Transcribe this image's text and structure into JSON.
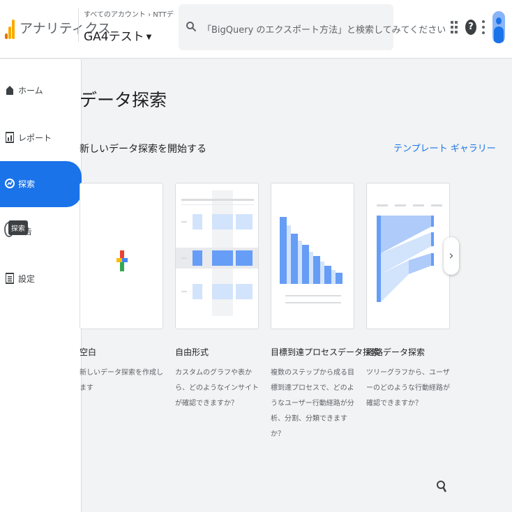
{
  "header": {
    "app_name": "アナリティクス",
    "breadcrumb": "すべてのアカウント › NTTデータ・スマート…",
    "property": "GA4テスト",
    "search_placeholder": "「BigQuery のエクスポート方法」と検索してみてください",
    "icons": [
      "apps-icon",
      "help-icon",
      "more-vert-icon",
      "avatar"
    ]
  },
  "sidebar": {
    "items": [
      {
        "label": "ホーム",
        "icon": "home-icon"
      },
      {
        "label": "レポート",
        "icon": "bar-chart-icon"
      },
      {
        "label": "探索",
        "icon": "explore-icon"
      },
      {
        "label": "広告",
        "icon": "ads-icon"
      },
      {
        "label": "設定",
        "icon": "list-icon"
      }
    ],
    "tooltip": "探索"
  },
  "main": {
    "title": "データ探索",
    "section_title": "新しいデータ探索を開始する",
    "gallery_link": "テンプレート ギャラリー",
    "cards": [
      {
        "title": "空白",
        "description": "新しいデータ探索を作成します"
      },
      {
        "title": "自由形式",
        "description": "カスタムのグラフや表から、どのようなインサイトが確認できますか？"
      },
      {
        "title": "目標到達プロセスデータ探索",
        "description": "複数のステップから成る目標到達プロセスで、どのようなユーザー行動経路が分析、分割、分類できますか？"
      },
      {
        "title": "経路データ探索",
        "description": "ツリーグラフから、ユーザーのどのような行動経路が確認できますか？"
      }
    ],
    "next_label": "›"
  },
  "colors": {
    "accent": "#1a73e8",
    "light_blue": "#aecbfa",
    "mid_blue": "#669df6"
  }
}
